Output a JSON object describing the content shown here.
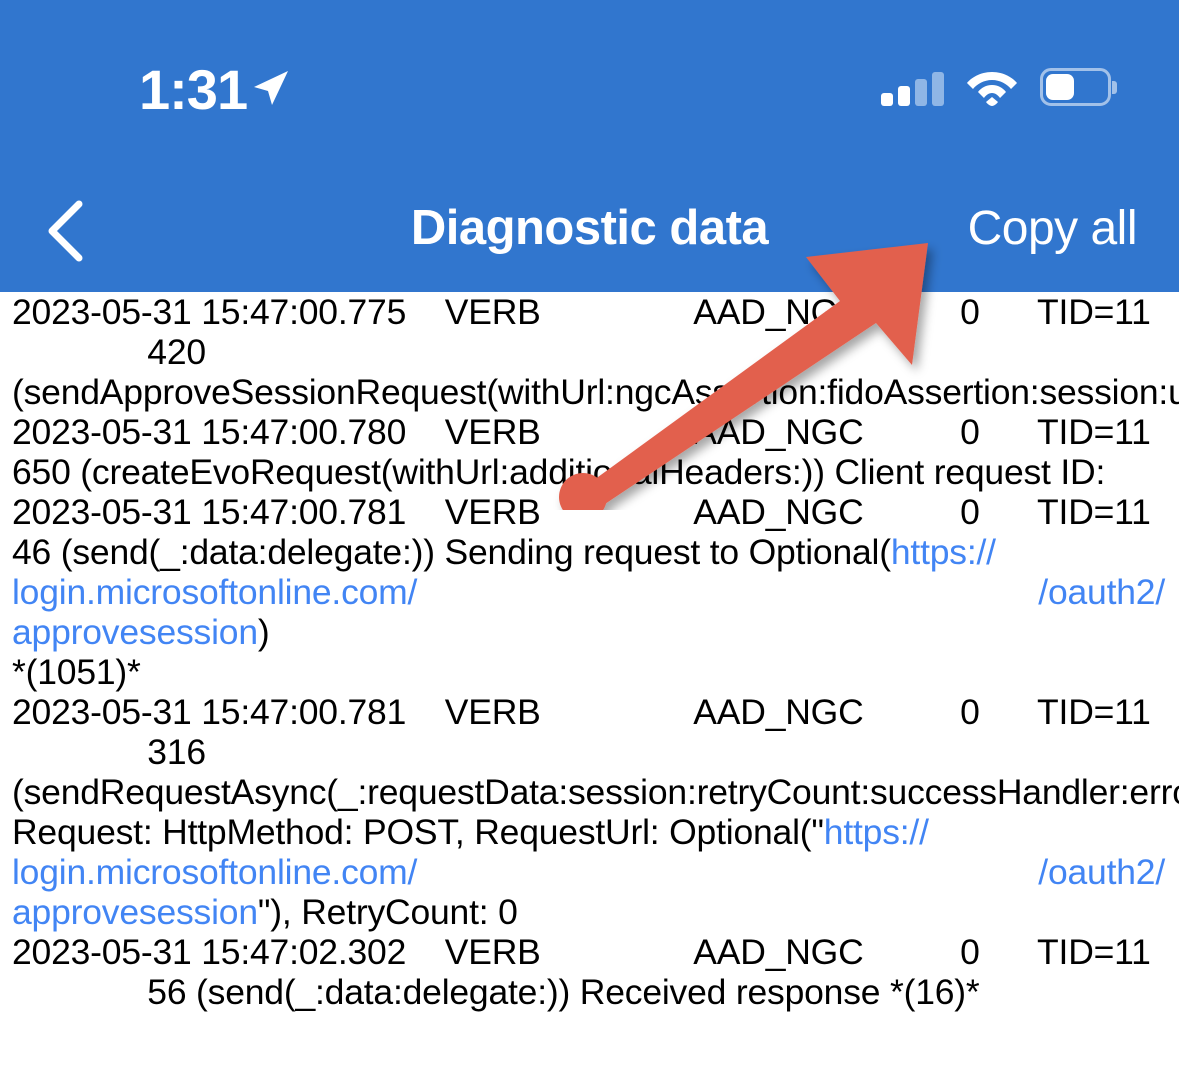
{
  "theme": {
    "header_blue": "#3176ce",
    "link_blue": "#4285f4",
    "annotation_red": "#e2604e",
    "body_bg": "#ffffff",
    "text_color": "#000000"
  },
  "status_bar": {
    "time": "1:31",
    "location_icon": "location-arrow-icon",
    "cellular_icon": "cellular-signal-icon",
    "cellular_bars_filled": 2,
    "cellular_bars_total": 4,
    "wifi_icon": "wifi-icon",
    "battery_icon": "battery-icon",
    "battery_level_percent": 45
  },
  "nav_bar": {
    "back_icon": "chevron-left-icon",
    "title": "Diagnostic data",
    "action_label": "Copy all"
  },
  "annotation": {
    "shape": "arrow-annotation",
    "points_to": "Copy all",
    "color": "#e2604e"
  },
  "log": {
    "lines": [
      {
        "id": "l1",
        "type": "plain",
        "text": "2023-05-31 15:47:00.775    VERB                AAD_NGC          0      TID=11"
      },
      {
        "id": "l2",
        "type": "plain",
        "text": "              420"
      },
      {
        "id": "l3",
        "type": "wrap",
        "text": "(sendApproveSessionRequest(withUrl:ngcAssertion:fidoAssertion:session:userObjectId:entropy:))"
      },
      {
        "id": "l4",
        "type": "plain",
        "text": "2023-05-31 15:47:00.780    VERB                AAD_NGC          0      TID=11"
      },
      {
        "id": "l5",
        "type": "wrap",
        "text": "              650 (createEvoRequest(withUrl:additionalHeaders:)) Client request ID:"
      },
      {
        "id": "l6",
        "type": "plain",
        "text": "2023-05-31 15:47:00.781    VERB                AAD_NGC          0      TID=11"
      },
      {
        "id": "l7",
        "type": "mixed1",
        "prefix": "              46 (send(_:data:delegate:)) Sending request to Optional(",
        "link": "https://"
      },
      {
        "id": "l8",
        "type": "justify",
        "left": "login.microsoftonline.com/",
        "right": "/oauth2/"
      },
      {
        "id": "l9",
        "type": "mixed2",
        "link": "approvesession",
        "suffix": ")"
      },
      {
        "id": "l10",
        "type": "plain",
        "text": "*(1051)*"
      },
      {
        "id": "l11",
        "type": "plain",
        "text": "2023-05-31 15:47:00.781    VERB                AAD_NGC          0      TID=11"
      },
      {
        "id": "l12",
        "type": "plain",
        "text": "              316"
      },
      {
        "id": "l13",
        "type": "wrap",
        "text": "(sendRequestAsync(_:requestData:session:retryCount:successHandler:errorHandler:)) Request: HttpMethod: POST, RequestUrl: Optional(\""
      },
      {
        "id": "l14",
        "type": "justify",
        "left": "login.microsoftonline.com/",
        "right": "/oauth2/"
      },
      {
        "id": "l15",
        "type": "mixed3",
        "link": "approvesession",
        "suffix": "\"), RetryCount: 0"
      },
      {
        "id": "l16",
        "type": "plain",
        "text": "2023-05-31 15:47:02.302    VERB                AAD_NGC          0      TID=11"
      },
      {
        "id": "l17",
        "type": "plain",
        "text": "              56 (send(_:data:delegate:)) Received response *(16)*"
      }
    ]
  }
}
